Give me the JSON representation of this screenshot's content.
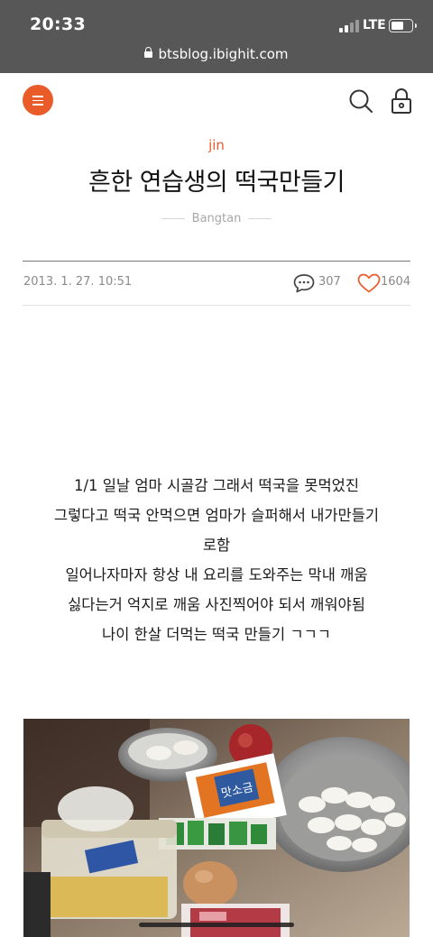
{
  "status_bar": {
    "time": "20:33",
    "network": "LTE",
    "url": "btsblog.ibighit.com"
  },
  "header": {
    "menu_icon": "hamburger-menu-icon",
    "search_icon": "search-icon",
    "lock_icon": "lock-icon",
    "accent_color": "#ea5b2a"
  },
  "post": {
    "category": "jin",
    "title": "흔한 연습생의 떡국만들기",
    "author": "Bangtan",
    "date": "2013. 1. 27. 10:51",
    "comment_count": "307",
    "like_count": "1604",
    "body_lines": [
      "1/1 일날 엄마 시골감  그래서 떡국을 못먹었진",
      "그렇다고 떡국 안먹으면 엄마가 슬퍼해서  내가만들기",
      "로함",
      "일어나자마자 항상 내 요리를 도와주는 막내 깨움",
      "싫다는거 억지로 깨움 사진찍어야 되서 깨워야됨",
      "나이 한살 더먹는 떡국 만들기 ㄱㄱㄱ"
    ],
    "photo_label": "맛소금"
  }
}
